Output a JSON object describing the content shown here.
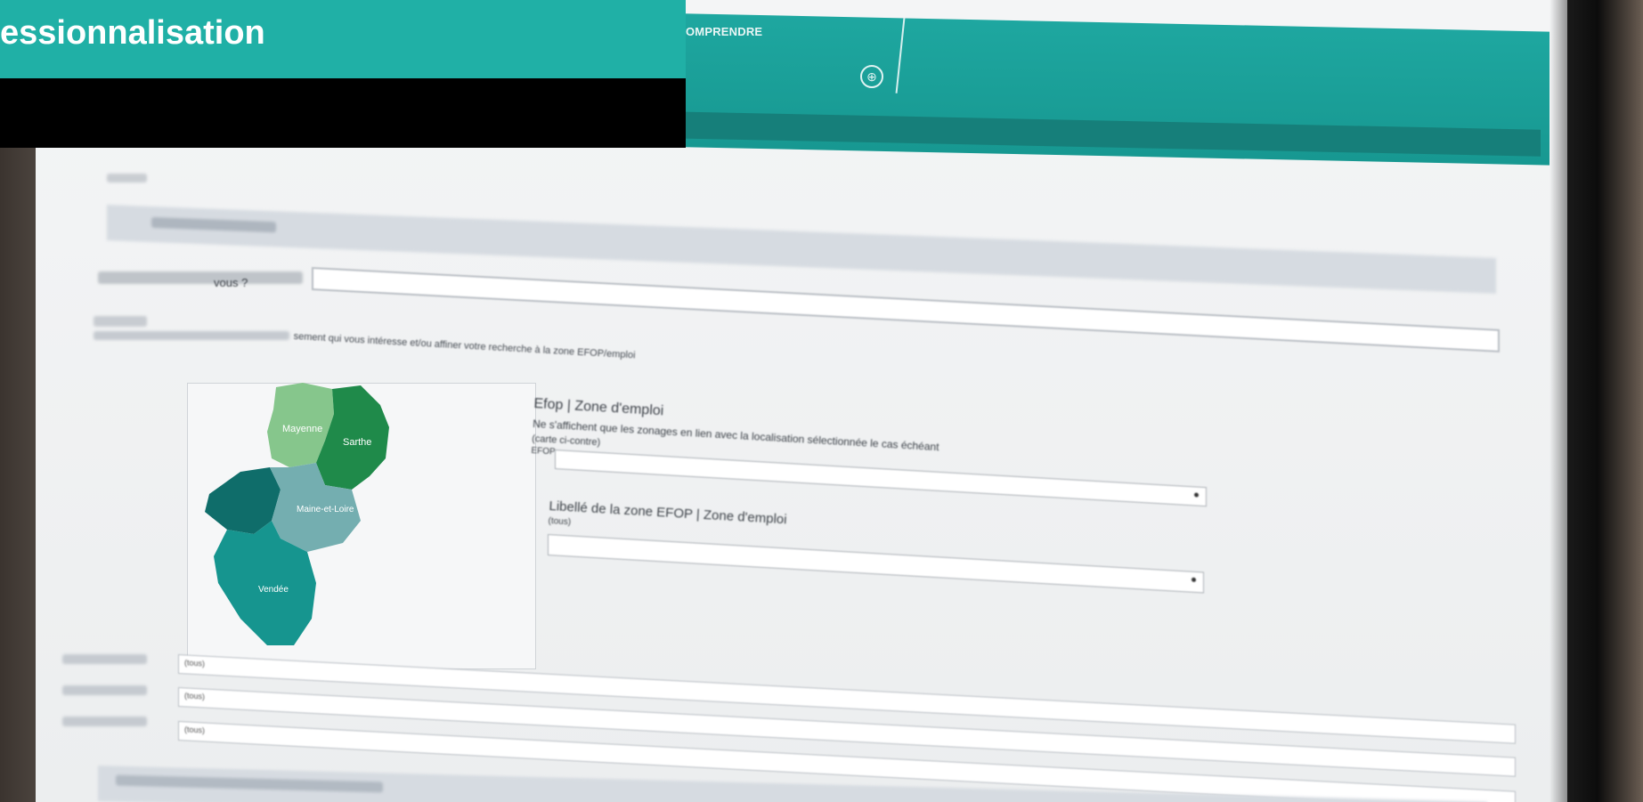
{
  "overlay": {
    "title": "essionnalisation"
  },
  "app_header": {
    "tab_label": "OMPRENDRE",
    "tab_icon": "⊕"
  },
  "form": {
    "question_label": "vous ?",
    "location_text": "sement qui vous intéresse et/ou affiner votre recherche à la zone EFOP/emploi",
    "map_regions": [
      "Mayenne",
      "Sarthe",
      "Maine-et-Loire",
      "Vendée"
    ],
    "efop": {
      "title": "Efop | Zone d'emploi",
      "description": "Ne s'affichent que les zonages en lien avec la localisation sélectionnée le cas échéant",
      "description2": "(carte ci-contre)",
      "value": "EFOP"
    },
    "libelle": {
      "title": "Libellé de la zone EFOP | Zone d'emploi",
      "value": "(tous)"
    },
    "rows": [
      {
        "value": "(tous)"
      },
      {
        "value": "(tous)"
      },
      {
        "value": "(tous)"
      }
    ]
  },
  "colors": {
    "brand_teal": "#20b0a6",
    "header_teal": "#1ea7a0"
  }
}
